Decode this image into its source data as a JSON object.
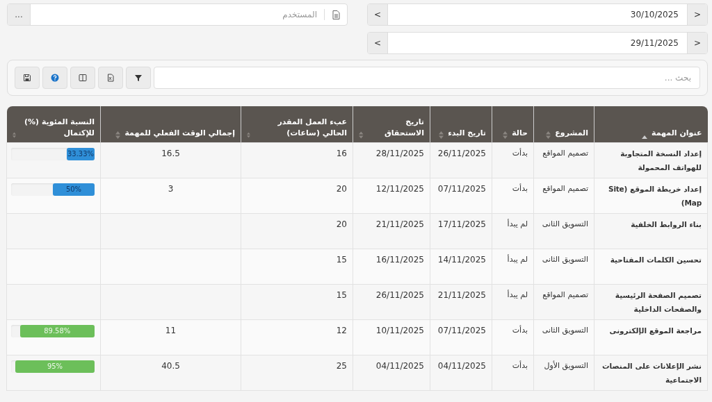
{
  "user_field": {
    "placeholder": "المستخدم",
    "more_button": "..."
  },
  "date_navs": [
    {
      "value": "30/10/2025",
      "next": ">",
      "prev": "<"
    },
    {
      "value": "29/11/2025",
      "next": ">",
      "prev": "<"
    }
  ],
  "toolbar": {
    "search_placeholder": "بحث ...",
    "buttons": [
      {
        "kind": "filter"
      },
      {
        "kind": "excel"
      },
      {
        "kind": "columns"
      },
      {
        "kind": "help"
      },
      {
        "kind": "save"
      }
    ]
  },
  "table": {
    "columns": [
      {
        "label": "عنوان المهمة",
        "sorted": true
      },
      {
        "label": "المشروع",
        "sorted": false
      },
      {
        "label": "حالة",
        "sorted": false
      },
      {
        "label": "تاريخ البدء",
        "sorted": false
      },
      {
        "label": "تاريخ الاستحقاق",
        "sorted": false
      },
      {
        "label": "عبء العمل المقدر الحالي (ساعات)",
        "sorted": false
      },
      {
        "label": "إجمالي الوقت الفعلي للمهمة",
        "sorted": false
      },
      {
        "label": "النسبة المئوية (%) للإكتمال",
        "sorted": false
      }
    ],
    "rows": [
      {
        "title": "إعداد النسخة المتجاوبة للهواتف المحمولة",
        "project": "تصميم المواقع",
        "status": "بدأت",
        "start": "26/11/2025",
        "due": "28/11/2025",
        "estimate": "16",
        "actual": "16.5",
        "progress": {
          "label": "33.33%",
          "level": 0.3333
        }
      },
      {
        "title": "إعداد خريطة الموقع (Site Map)",
        "project": "تصميم المواقع",
        "status": "بدأت",
        "start": "07/11/2025",
        "due": "12/11/2025",
        "estimate": "20",
        "actual": "3",
        "progress": {
          "label": "50%",
          "level": 0.5
        }
      },
      {
        "title": "بناء الروابط الخلفية",
        "project": "التسويق الثانى",
        "status": "لم يبدأ",
        "start": "17/11/2025",
        "due": "21/11/2025",
        "estimate": "20"
      },
      {
        "title": "تحسين الكلمات المفتاحية",
        "project": "التسويق الثانى",
        "status": "لم يبدأ",
        "start": "14/11/2025",
        "due": "16/11/2025",
        "estimate": "15"
      },
      {
        "title": "تصميم الصفحة الرئيسية والصفحات الداخلية",
        "project": "تصميم المواقع",
        "status": "لم يبدأ",
        "start": "21/11/2025",
        "due": "26/11/2025",
        "estimate": "15"
      },
      {
        "title": "مراجعة الموقع الإلكترونى",
        "project": "التسويق الثانى",
        "status": "بدأت",
        "start": "07/11/2025",
        "due": "10/11/2025",
        "estimate": "12",
        "actual": "11",
        "progress": {
          "label": "89.58%",
          "level": 0.8958
        }
      },
      {
        "title": "نشر الإعلانات على المنصات الاجتماعية",
        "project": "التسويق الأول",
        "status": "بدأت",
        "start": "04/11/2025",
        "due": "04/11/2025",
        "estimate": "25",
        "actual": "40.5",
        "progress": {
          "label": "95%",
          "level": 0.95
        }
      }
    ]
  }
}
